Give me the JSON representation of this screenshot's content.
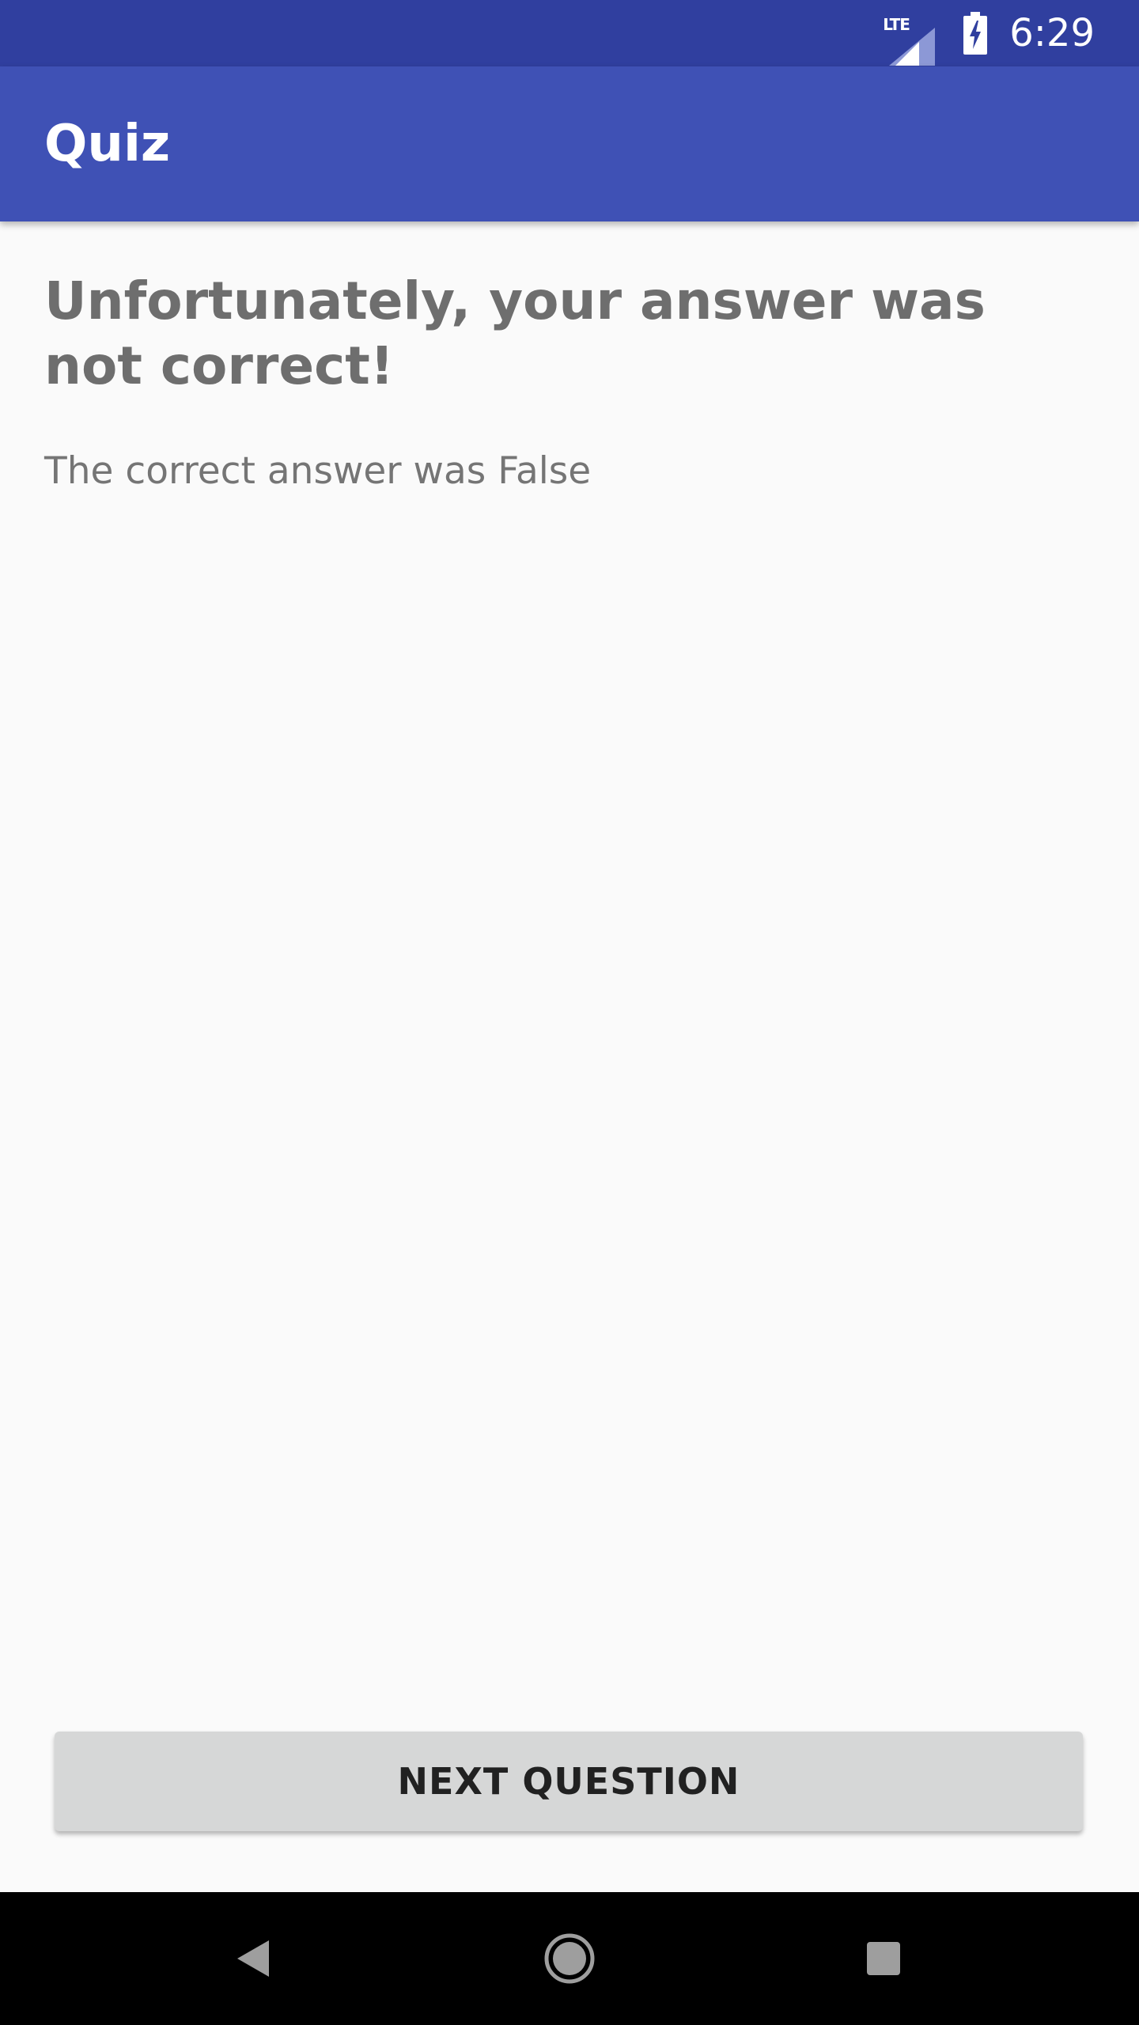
{
  "status_bar": {
    "network_label": "LTE",
    "time": "6:29",
    "icons": [
      "lte-signal-icon",
      "battery-charging-icon"
    ]
  },
  "app_bar": {
    "title": "Quiz"
  },
  "result": {
    "title": "Unfortunately, your answer was not correct!",
    "detail": "The correct answer was False"
  },
  "actions": {
    "next_question_label": "NEXT QUESTION"
  },
  "nav_bar": {
    "icons": [
      "back-icon",
      "home-icon",
      "recents-icon"
    ]
  },
  "colors": {
    "status_bar": "#303f9f",
    "app_bar": "#3f51b5",
    "background": "#fafafa",
    "title_text": "#6e6e6e",
    "button": "#d6d7d7",
    "nav_bar": "#000000"
  }
}
